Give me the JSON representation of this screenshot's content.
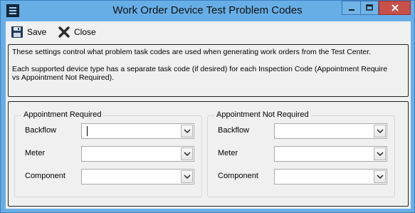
{
  "window": {
    "title": "Work Order Device Test Problem Codes",
    "icons": {
      "app": "app-icon",
      "minimize": "minimize-icon",
      "maximize": "maximize-icon",
      "close": "close-icon"
    },
    "colors": {
      "frame": "#67aee6",
      "close_button": "#c7504b"
    }
  },
  "toolbar": {
    "save_label": "Save",
    "close_label": "Close",
    "save_icon": "floppy-disk-icon",
    "close_icon": "x-icon"
  },
  "info": {
    "line1": "These settings control what problem task codes are used when generating work orders from the Test Center.",
    "line2": "Each supported device type has a separate task code (if desired) for each Inspection Code (Appointment Require",
    "line3": "vs Appointment Not Required)."
  },
  "groups": {
    "left": {
      "title": "Appointment Required",
      "rows": [
        {
          "label": "Backflow",
          "value": ""
        },
        {
          "label": "Meter",
          "value": ""
        },
        {
          "label": "Component",
          "value": ""
        }
      ]
    },
    "right": {
      "title": "Appointment Not Required",
      "rows": [
        {
          "label": "Backflow",
          "value": ""
        },
        {
          "label": "Meter",
          "value": ""
        },
        {
          "label": "Component",
          "value": ""
        }
      ]
    }
  }
}
